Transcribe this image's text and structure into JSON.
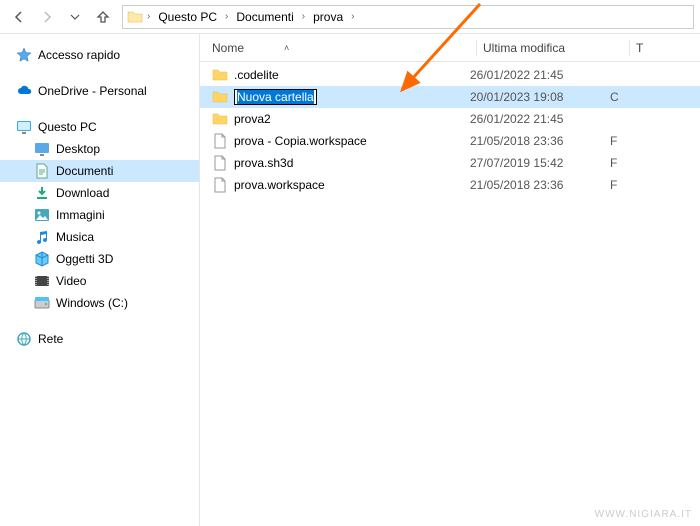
{
  "breadcrumb": {
    "items": [
      {
        "label": "Questo PC"
      },
      {
        "label": "Documenti"
      },
      {
        "label": "prova"
      }
    ]
  },
  "sidebar": {
    "quickaccess": {
      "label": "Accesso rapido"
    },
    "onedrive": {
      "label": "OneDrive - Personal"
    },
    "thispc": {
      "label": "Questo PC"
    },
    "children": [
      {
        "label": "Desktop",
        "icon": "desktop"
      },
      {
        "label": "Documenti",
        "icon": "documents",
        "selected": true
      },
      {
        "label": "Download",
        "icon": "download"
      },
      {
        "label": "Immagini",
        "icon": "pictures"
      },
      {
        "label": "Musica",
        "icon": "music"
      },
      {
        "label": "Oggetti 3D",
        "icon": "objects3d"
      },
      {
        "label": "Video",
        "icon": "video"
      },
      {
        "label": "Windows (C:)",
        "icon": "drive"
      }
    ],
    "network": {
      "label": "Rete"
    }
  },
  "columns": {
    "name": "Nome",
    "modified": "Ultima modifica",
    "type": "T"
  },
  "files": [
    {
      "name": ".codelite",
      "date": "26/01/2022 21:45",
      "type": "",
      "icon": "folder"
    },
    {
      "name": "Nuova cartella",
      "date": "20/01/2023 19:08",
      "type": "C",
      "icon": "folder",
      "selected": true,
      "renaming": true
    },
    {
      "name": "prova2",
      "date": "26/01/2022 21:45",
      "type": "",
      "icon": "folder"
    },
    {
      "name": "prova - Copia.workspace",
      "date": "21/05/2018 23:36",
      "type": "F",
      "icon": "file"
    },
    {
      "name": "prova.sh3d",
      "date": "27/07/2019 15:42",
      "type": "F",
      "icon": "file"
    },
    {
      "name": "prova.workspace",
      "date": "21/05/2018 23:36",
      "type": "F",
      "icon": "file"
    }
  ],
  "watermark": "WWW.NIGIARA.IT"
}
